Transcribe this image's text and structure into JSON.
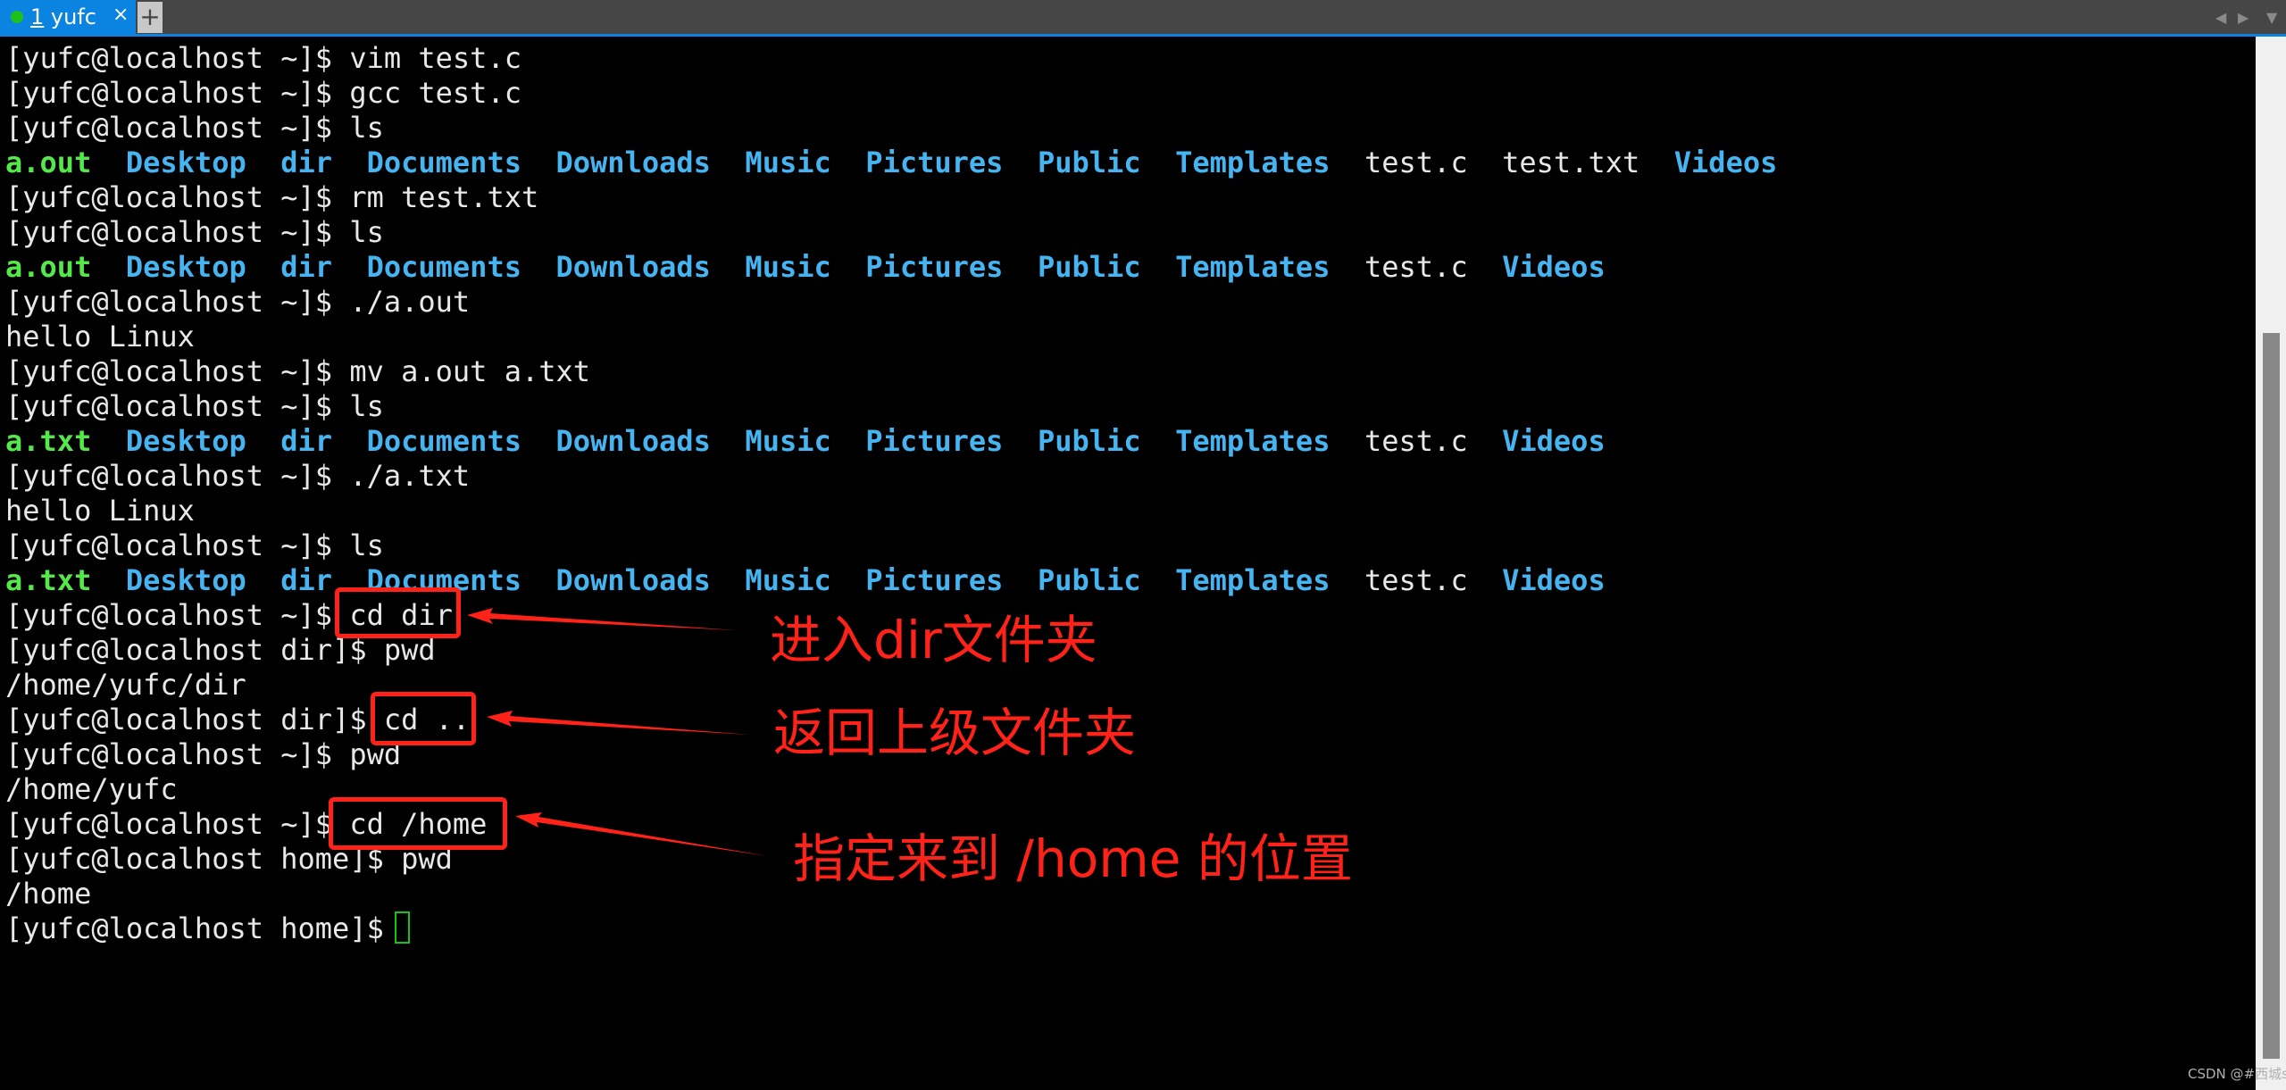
{
  "tabbar": {
    "tab": {
      "number": "1",
      "name": "yufc",
      "status_color": "#1cc21c",
      "close_label": "×"
    },
    "new_tab_label": "+",
    "nav_left": "◀",
    "nav_right": "▶",
    "menu": "▼"
  },
  "colors": {
    "executable": "#55e84a",
    "directory": "#46b4f0",
    "text": "#e8e8e8",
    "annotation": "#ff2219",
    "tab_accent": "#0a84e0"
  },
  "terminal": {
    "lines": [
      {
        "type": "cmd",
        "prompt": "[yufc@localhost ~]$ ",
        "command": "vim test.c"
      },
      {
        "type": "cmd",
        "prompt": "[yufc@localhost ~]$ ",
        "command": "gcc test.c"
      },
      {
        "type": "cmd",
        "prompt": "[yufc@localhost ~]$ ",
        "command": "ls"
      },
      {
        "type": "ls",
        "entries": [
          {
            "name": "a.out",
            "kind": "g"
          },
          {
            "name": "Desktop",
            "kind": "b"
          },
          {
            "name": "dir",
            "kind": "b"
          },
          {
            "name": "Documents",
            "kind": "b"
          },
          {
            "name": "Downloads",
            "kind": "b"
          },
          {
            "name": "Music",
            "kind": "b"
          },
          {
            "name": "Pictures",
            "kind": "b"
          },
          {
            "name": "Public",
            "kind": "b"
          },
          {
            "name": "Templates",
            "kind": "b"
          },
          {
            "name": "test.c",
            "kind": "f"
          },
          {
            "name": "test.txt",
            "kind": "f"
          },
          {
            "name": "Videos",
            "kind": "b"
          }
        ]
      },
      {
        "type": "cmd",
        "prompt": "[yufc@localhost ~]$ ",
        "command": "rm test.txt"
      },
      {
        "type": "cmd",
        "prompt": "[yufc@localhost ~]$ ",
        "command": "ls"
      },
      {
        "type": "ls",
        "entries": [
          {
            "name": "a.out",
            "kind": "g"
          },
          {
            "name": "Desktop",
            "kind": "b"
          },
          {
            "name": "dir",
            "kind": "b"
          },
          {
            "name": "Documents",
            "kind": "b"
          },
          {
            "name": "Downloads",
            "kind": "b"
          },
          {
            "name": "Music",
            "kind": "b"
          },
          {
            "name": "Pictures",
            "kind": "b"
          },
          {
            "name": "Public",
            "kind": "b"
          },
          {
            "name": "Templates",
            "kind": "b"
          },
          {
            "name": "test.c",
            "kind": "f"
          },
          {
            "name": "Videos",
            "kind": "b"
          }
        ]
      },
      {
        "type": "cmd",
        "prompt": "[yufc@localhost ~]$ ",
        "command": "./a.out"
      },
      {
        "type": "out",
        "text": "hello Linux"
      },
      {
        "type": "cmd",
        "prompt": "[yufc@localhost ~]$ ",
        "command": "mv a.out a.txt"
      },
      {
        "type": "cmd",
        "prompt": "[yufc@localhost ~]$ ",
        "command": "ls"
      },
      {
        "type": "ls",
        "entries": [
          {
            "name": "a.txt",
            "kind": "g"
          },
          {
            "name": "Desktop",
            "kind": "b"
          },
          {
            "name": "dir",
            "kind": "b"
          },
          {
            "name": "Documents",
            "kind": "b"
          },
          {
            "name": "Downloads",
            "kind": "b"
          },
          {
            "name": "Music",
            "kind": "b"
          },
          {
            "name": "Pictures",
            "kind": "b"
          },
          {
            "name": "Public",
            "kind": "b"
          },
          {
            "name": "Templates",
            "kind": "b"
          },
          {
            "name": "test.c",
            "kind": "f"
          },
          {
            "name": "Videos",
            "kind": "b"
          }
        ]
      },
      {
        "type": "cmd",
        "prompt": "[yufc@localhost ~]$ ",
        "command": "./a.txt"
      },
      {
        "type": "out",
        "text": "hello Linux"
      },
      {
        "type": "cmd",
        "prompt": "[yufc@localhost ~]$ ",
        "command": "ls"
      },
      {
        "type": "ls",
        "entries": [
          {
            "name": "a.txt",
            "kind": "g"
          },
          {
            "name": "Desktop",
            "kind": "b"
          },
          {
            "name": "dir",
            "kind": "b"
          },
          {
            "name": "Documents",
            "kind": "b"
          },
          {
            "name": "Downloads",
            "kind": "b"
          },
          {
            "name": "Music",
            "kind": "b"
          },
          {
            "name": "Pictures",
            "kind": "b"
          },
          {
            "name": "Public",
            "kind": "b"
          },
          {
            "name": "Templates",
            "kind": "b"
          },
          {
            "name": "test.c",
            "kind": "f"
          },
          {
            "name": "Videos",
            "kind": "b"
          }
        ]
      },
      {
        "type": "cmd",
        "prompt": "[yufc@localhost ~]$ ",
        "command": "cd dir"
      },
      {
        "type": "cmd",
        "prompt": "[yufc@localhost dir]$ ",
        "command": "pwd"
      },
      {
        "type": "out",
        "text": "/home/yufc/dir"
      },
      {
        "type": "cmd",
        "prompt": "[yufc@localhost dir]$ ",
        "command": "cd .."
      },
      {
        "type": "cmd",
        "prompt": "[yufc@localhost ~]$ ",
        "command": "pwd"
      },
      {
        "type": "out",
        "text": "/home/yufc"
      },
      {
        "type": "cmd",
        "prompt": "[yufc@localhost ~]$ ",
        "command": "cd /home"
      },
      {
        "type": "cmd",
        "prompt": "[yufc@localhost home]$ ",
        "command": "pwd"
      },
      {
        "type": "out",
        "text": "/home"
      },
      {
        "type": "cmd",
        "prompt": "[yufc@localhost home]$ ",
        "command": ""
      }
    ]
  },
  "annotations": [
    {
      "label": "进入dir文件夹",
      "target_command": "cd dir"
    },
    {
      "label": "返回上级文件夹",
      "target_command": "cd .."
    },
    {
      "label": "指定来到 /home 的位置",
      "target_command": "cd /home"
    }
  ],
  "watermark": "CSDN @#西城s"
}
